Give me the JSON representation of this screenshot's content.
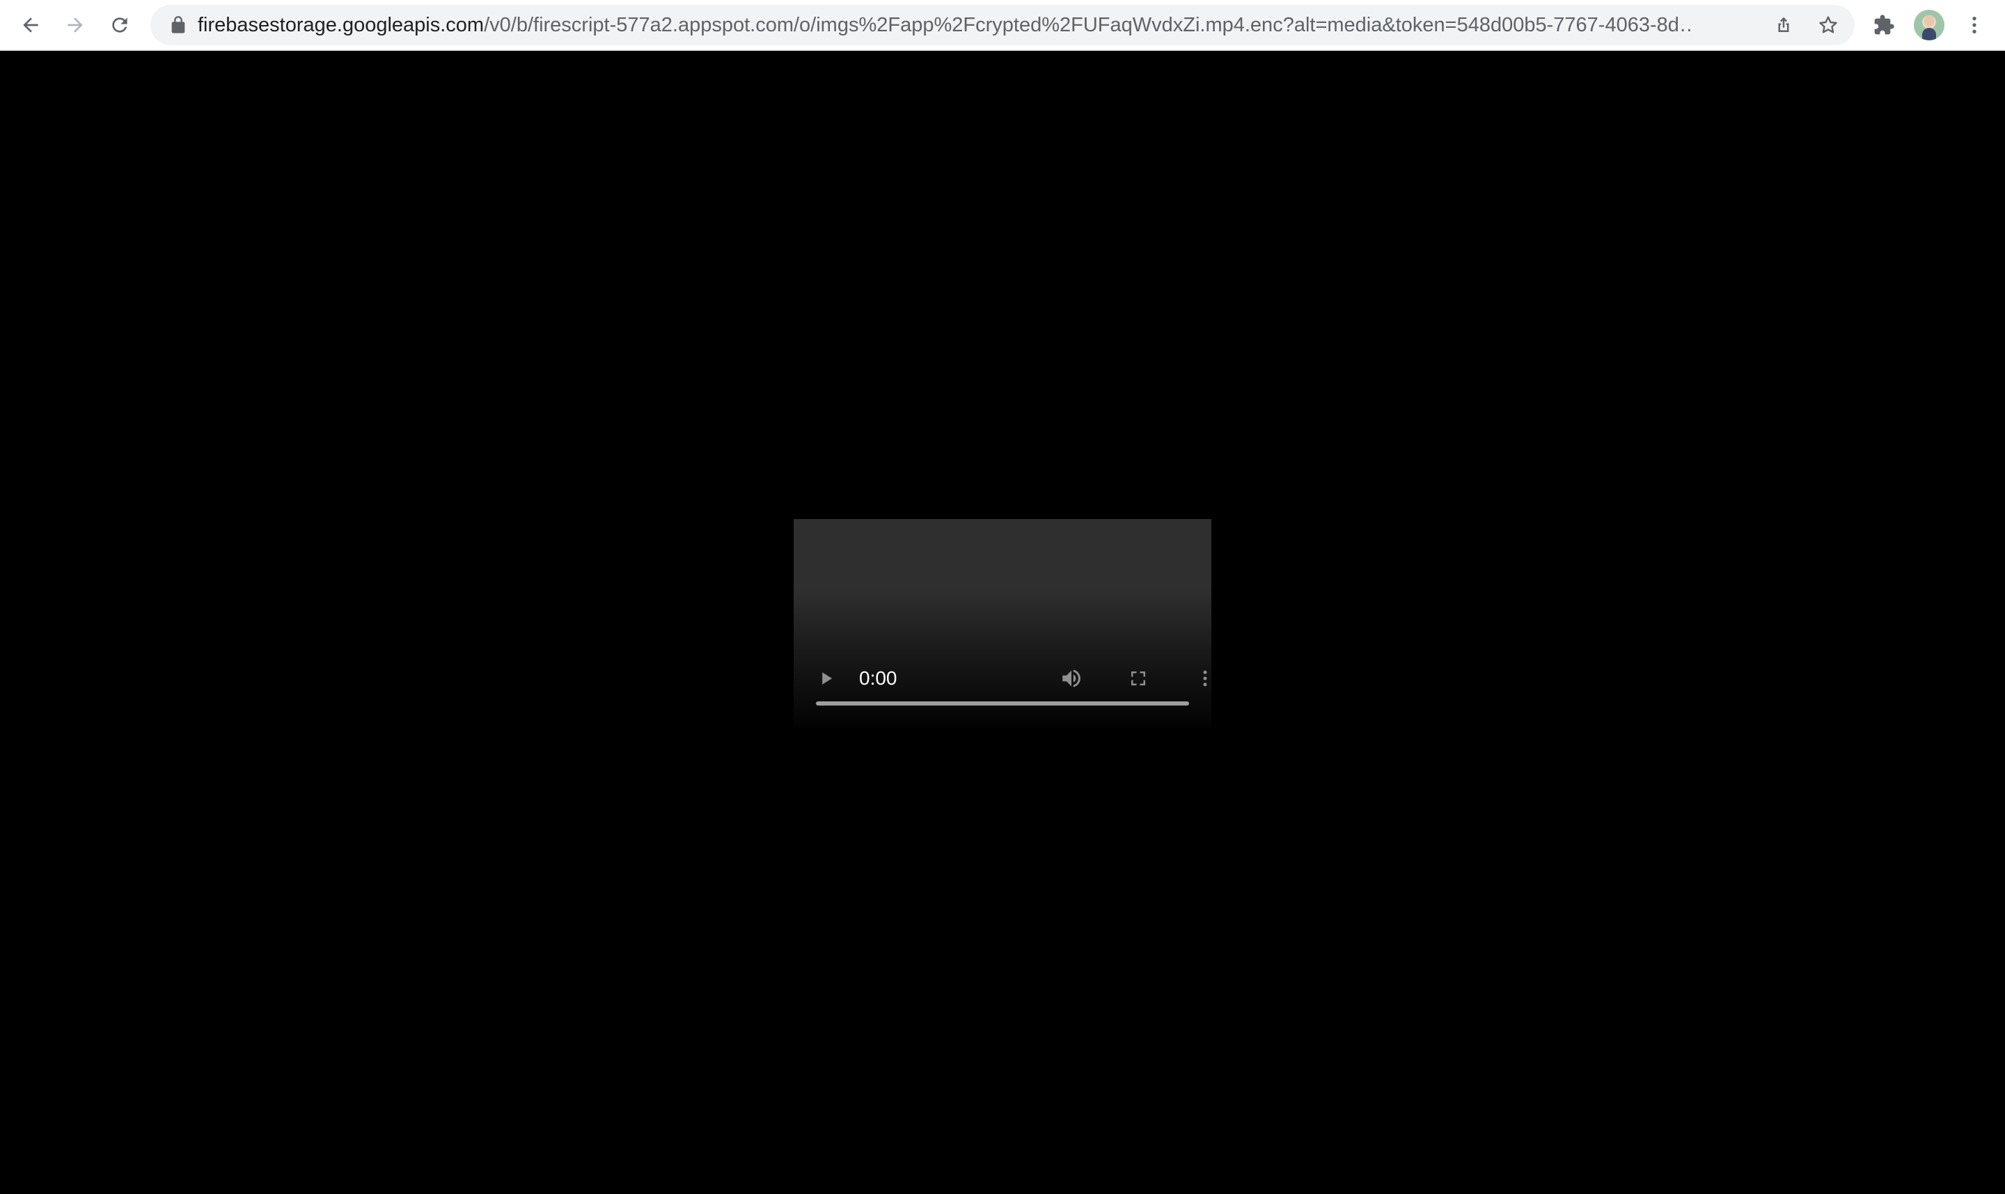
{
  "browser": {
    "url_host": "firebasestorage.googleapis.com",
    "url_path": "/v0/b/firescript-577a2.appspot.com/o/imgs%2Fapp%2Fcrypted%2FUFaqWvdxZi.mp4.enc?alt=media&token=548d00b5-7767-4063-8d…",
    "icons": {
      "back": "back-arrow-icon",
      "forward": "forward-arrow-icon",
      "reload": "reload-icon",
      "lock": "lock-icon",
      "share": "share-icon",
      "bookmark": "star-icon",
      "extensions": "puzzle-icon",
      "menu": "kebab-menu-icon"
    }
  },
  "video": {
    "current_time": "0:00",
    "progress": 0
  },
  "colors": {
    "page_background": "#000000",
    "video_background": "#2f2f2f",
    "toolbar_background": "#ffffff",
    "omnibox_background": "#f1f3f4"
  }
}
